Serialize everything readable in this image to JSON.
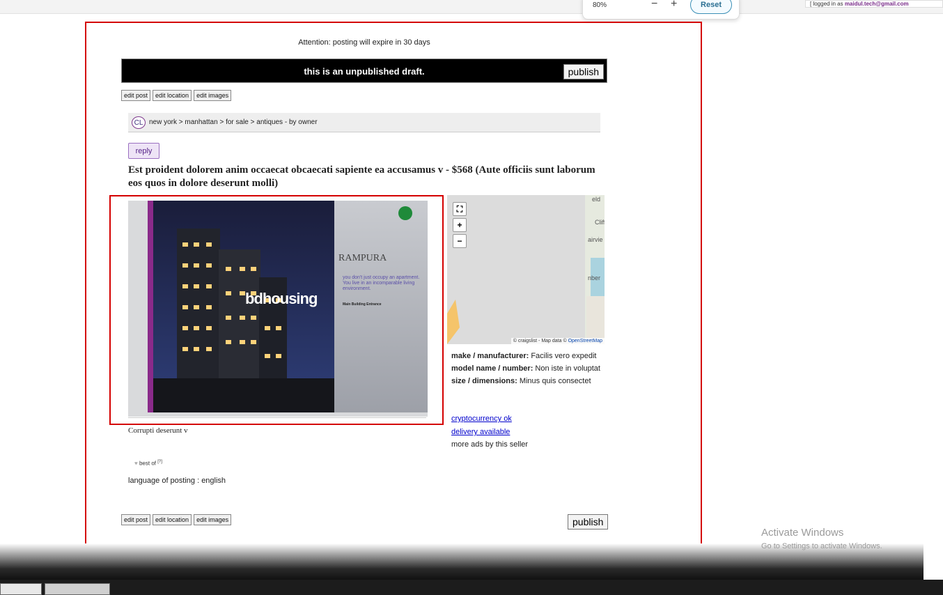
{
  "zoom": {
    "percent": "80%",
    "minus": "−",
    "plus": "+",
    "reset": "Reset"
  },
  "session": {
    "prefix": "[ logged in as ",
    "email": "maidul.tech@gmail.com"
  },
  "notice": {
    "attention": "Attention: posting will expire in 30 days",
    "draft": "this is an unpublished draft.",
    "publish": "publish"
  },
  "edit": {
    "post": "edit post",
    "location": "edit location",
    "images": "edit images"
  },
  "breadcrumb": {
    "logo": "CL",
    "path": "new york > manhattan > for sale > antiques - by owner"
  },
  "reply": "reply",
  "posting": {
    "title": "Est proident dolorem anim occaecat obcaecati sapiente ea accusamus v - $568 (Aute officiis sunt laborum eos quos in dolore deserunt molli)",
    "caption": "Corrupti deserunt v",
    "best_of": "best of",
    "best_of_ref": "[?]",
    "language": "language of posting : english"
  },
  "image_text": {
    "brand": "bdhousing",
    "project": "RAMPURA",
    "tagline": "you don't just occupy an apartment. You live in an incomparable living environment.",
    "heading": "Main Building Entrance"
  },
  "map": {
    "credit": "© craigslist - Map data © ",
    "osm": "OpenStreetMap",
    "labels": [
      "eld",
      "Cliff",
      "airvie",
      "nber"
    ]
  },
  "attributes": [
    {
      "label": "make / manufacturer:",
      "value": "Facilis vero expedit"
    },
    {
      "label": "model name / number:",
      "value": "Non iste in voluptat"
    },
    {
      "label": "size / dimensions:",
      "value": "Minus quis consectet"
    }
  ],
  "links": {
    "crypto": "cryptocurrency ok",
    "delivery": "delivery available",
    "more": "more ads by this seller"
  },
  "watermark": {
    "title": "Activate Windows",
    "subtitle": "Go to Settings to activate Windows."
  }
}
